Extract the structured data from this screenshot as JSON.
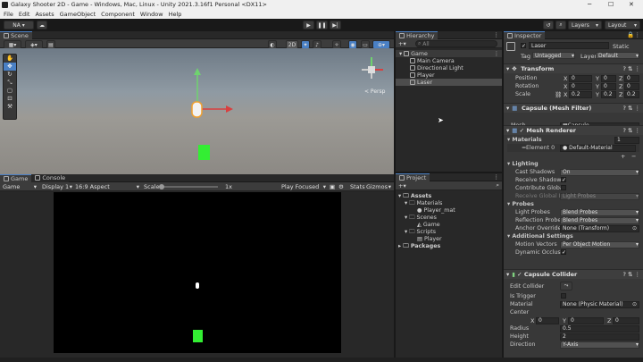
{
  "window": {
    "title": "Galaxy Shooter 2D - Game - Windows, Mac, Linux - Unity 2021.3.16f1 Personal <DX11>"
  },
  "menu": [
    "File",
    "Edit",
    "Assets",
    "GameObject",
    "Component",
    "Window",
    "Help"
  ],
  "toolbar": {
    "account": "NA",
    "layers": "Layers",
    "layout": "Layout"
  },
  "scene": {
    "tab": "Scene",
    "mode_2d": "2D",
    "persp": "< Persp"
  },
  "hierarchy": {
    "tab": "Hierarchy",
    "search_placeholder": "All",
    "scene_name": "Game",
    "objects": [
      "Main Camera",
      "Directional Light",
      "Player",
      "Laser"
    ]
  },
  "game": {
    "tab_game": "Game",
    "tab_console": "Console",
    "display": "Game",
    "display_no": "Display 1",
    "aspect": "16:9 Aspect",
    "scale_label": "Scale",
    "scale_value": "1x",
    "play_focused": "Play Focused",
    "stats": "Stats",
    "gizmos": "Gizmos"
  },
  "project": {
    "tab": "Project",
    "assets": "Assets",
    "materials": "Materials",
    "player_mat": "Player_mat",
    "scenes": "Scenes",
    "game_scene": "Game",
    "scripts": "Scripts",
    "player_script": "Player",
    "packages": "Packages"
  },
  "inspector": {
    "tab": "Inspector",
    "name": "Laser",
    "static": "Static",
    "tag_label": "Tag",
    "tag": "Untagged",
    "layer_label": "Layer",
    "layer": "Default",
    "transform": {
      "title": "Transform",
      "position_label": "Position",
      "position": [
        "0",
        "0",
        "0"
      ],
      "rotation_label": "Rotation",
      "rotation": [
        "0",
        "0",
        "0"
      ],
      "scale_label": "Scale",
      "scale": [
        "0.2",
        "0.2",
        "0.2"
      ]
    },
    "mesh_filter": {
      "title": "Capsule (Mesh Filter)",
      "mesh_label": "Mesh",
      "mesh": "Capsule"
    },
    "mesh_renderer": {
      "title": "Mesh Renderer",
      "materials_label": "Materials",
      "materials_count": "1",
      "element0_label": "Element 0",
      "element0": "Default-Material",
      "lighting_label": "Lighting",
      "cast_shadows_label": "Cast Shadows",
      "cast_shadows": "On",
      "receive_shadows_label": "Receive Shadows",
      "contribute_gi_label": "Contribute Global",
      "receive_gi_label": "Receive Global Ill",
      "receive_gi": "Light Probes",
      "probes_label": "Probes",
      "light_probes_label": "Light Probes",
      "light_probes": "Blend Probes",
      "reflection_probes_label": "Reflection Probes",
      "reflection_probes": "Blend Probes",
      "anchor_override_label": "Anchor Override",
      "anchor_override": "None (Transform)",
      "additional_label": "Additional Settings",
      "motion_vectors_label": "Motion Vectors",
      "motion_vectors": "Per Object Motion",
      "dynamic_occlusion_label": "Dynamic Occlusic"
    },
    "capsule_collider": {
      "title": "Capsule Collider",
      "edit_label": "Edit Collider",
      "is_trigger_label": "Is Trigger",
      "material_label": "Material",
      "material": "None (Physic Material)",
      "center_label": "Center",
      "center": [
        "0",
        "0",
        "0"
      ],
      "radius_label": "Radius",
      "radius": "0.5",
      "height_label": "Height",
      "height": "2",
      "direction_label": "Direction",
      "direction": "Y-Axis"
    }
  }
}
